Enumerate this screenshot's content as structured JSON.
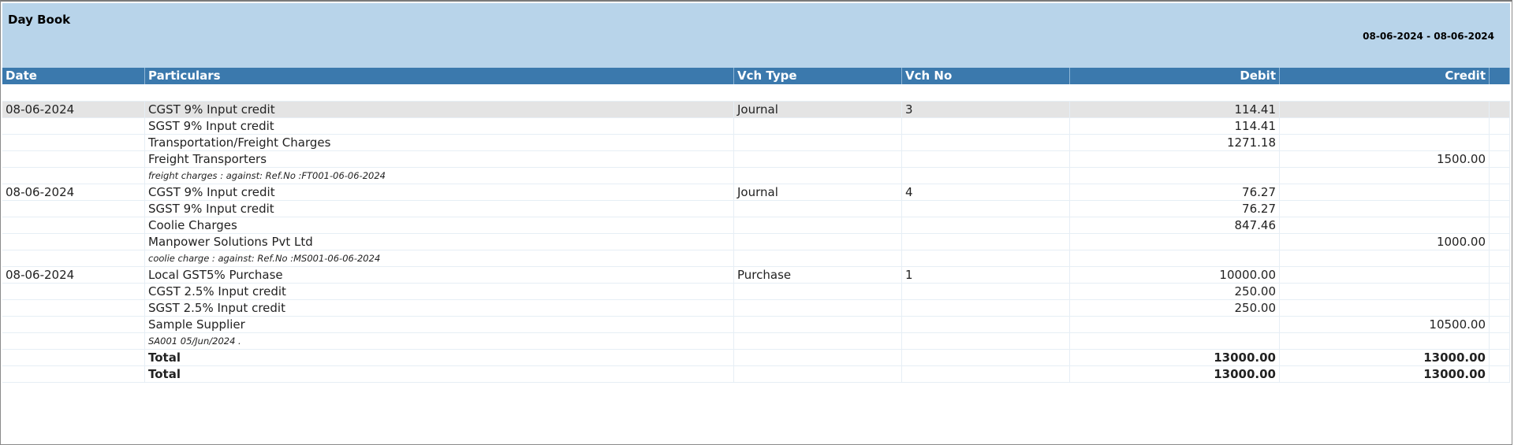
{
  "window": {
    "title": "Day Book",
    "period": "08-06-2024 - 08-06-2024"
  },
  "columns": {
    "date": "Date",
    "particulars": "Particulars",
    "vch_type": "Vch Type",
    "vch_no": "Vch No",
    "debit": "Debit",
    "credit": "Credit"
  },
  "rows": [
    {
      "date": "08-06-2024",
      "particulars": "CGST 9% Input credit",
      "vch_type": "Journal",
      "vch_no": "3",
      "debit": "114.41",
      "credit": ""
    },
    {
      "date": "",
      "particulars": "SGST 9% Input credit",
      "vch_type": "",
      "vch_no": "",
      "debit": "114.41",
      "credit": ""
    },
    {
      "date": "",
      "particulars": "Transportation/Freight Charges",
      "vch_type": "",
      "vch_no": "",
      "debit": "1271.18",
      "credit": ""
    },
    {
      "date": "",
      "particulars": "Freight Transporters",
      "vch_type": "",
      "vch_no": "",
      "debit": "",
      "credit": "1500.00"
    },
    {
      "date": "",
      "particulars": "freight charges : against: Ref.No :FT001-06-06-2024",
      "vch_type": "",
      "vch_no": "",
      "debit": "",
      "credit": ""
    },
    {
      "date": "08-06-2024",
      "particulars": "CGST 9% Input credit",
      "vch_type": "Journal",
      "vch_no": "4",
      "debit": "76.27",
      "credit": ""
    },
    {
      "date": "",
      "particulars": "SGST 9% Input credit",
      "vch_type": "",
      "vch_no": "",
      "debit": "76.27",
      "credit": ""
    },
    {
      "date": "",
      "particulars": "Coolie Charges",
      "vch_type": "",
      "vch_no": "",
      "debit": "847.46",
      "credit": ""
    },
    {
      "date": "",
      "particulars": "Manpower Solutions Pvt Ltd",
      "vch_type": "",
      "vch_no": "",
      "debit": "",
      "credit": "1000.00"
    },
    {
      "date": "",
      "particulars": "coolie charge : against: Ref.No :MS001-06-06-2024",
      "vch_type": "",
      "vch_no": "",
      "debit": "",
      "credit": ""
    },
    {
      "date": "08-06-2024",
      "particulars": "Local GST5% Purchase",
      "vch_type": "Purchase",
      "vch_no": "1",
      "debit": "10000.00",
      "credit": ""
    },
    {
      "date": "",
      "particulars": "CGST 2.5% Input credit",
      "vch_type": "",
      "vch_no": "",
      "debit": "250.00",
      "credit": ""
    },
    {
      "date": "",
      "particulars": "SGST 2.5% Input credit",
      "vch_type": "",
      "vch_no": "",
      "debit": "250.00",
      "credit": ""
    },
    {
      "date": "",
      "particulars": "Sample Supplier",
      "vch_type": "",
      "vch_no": "",
      "debit": "",
      "credit": "10500.00"
    },
    {
      "date": "",
      "particulars": "SA001 05/Jun/2024 .",
      "vch_type": "",
      "vch_no": "",
      "debit": "",
      "credit": ""
    },
    {
      "date": "",
      "particulars": "Total",
      "vch_type": "",
      "vch_no": "",
      "debit": "13000.00",
      "credit": "13000.00"
    },
    {
      "date": "",
      "particulars": "Total",
      "vch_type": "",
      "vch_no": "",
      "debit": "13000.00",
      "credit": "13000.00"
    }
  ]
}
